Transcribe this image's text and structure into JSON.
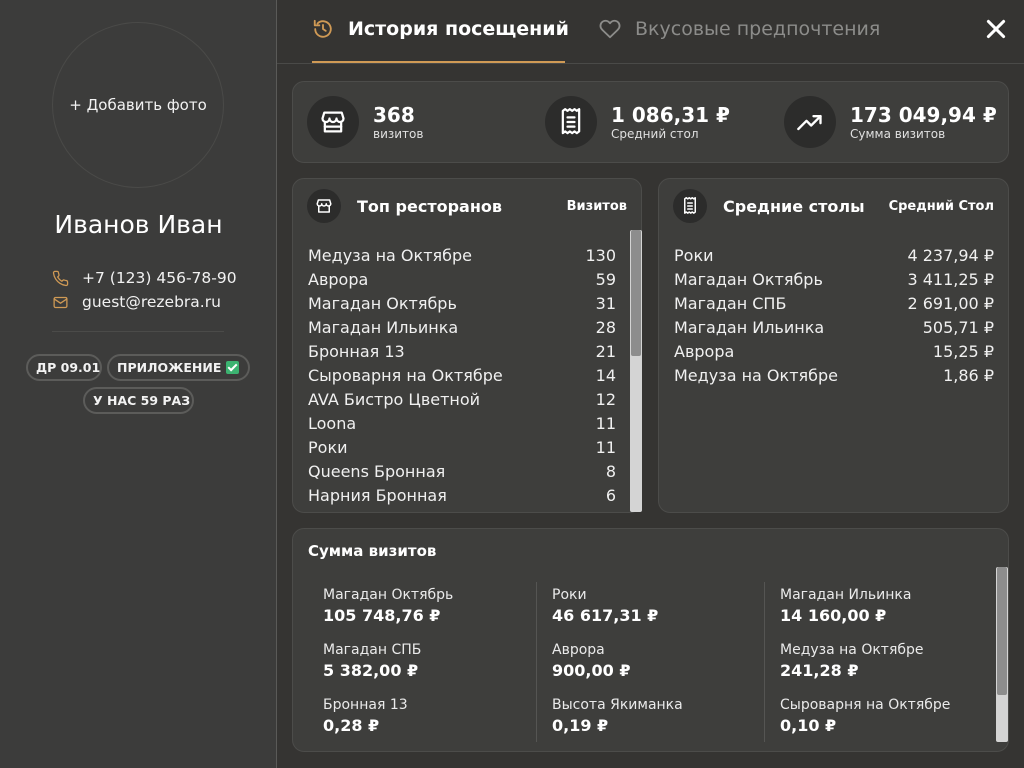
{
  "sidebar": {
    "add_photo": "+ Добавить фото",
    "guest_name": "Иванов Иван",
    "phone": "+7 (123) 456-78-90",
    "email": "guest@rezebra.ru",
    "tags": [
      "ДР 09.01",
      "ПРИЛОЖЕНИЕ",
      "У НАС 59 РАЗ"
    ],
    "accent_color": "#d09a55"
  },
  "tabs": [
    {
      "label": "История посещений",
      "icon": "history-icon",
      "active": true
    },
    {
      "label": "Вкусовые предпочтения",
      "icon": "heart-icon",
      "active": false
    }
  ],
  "stats": [
    {
      "value": "368",
      "label": "визитов",
      "icon": "store-icon"
    },
    {
      "value": "1 086,31 ₽",
      "label": "Средний стол",
      "icon": "receipt-icon"
    },
    {
      "value": "173 049,94 ₽",
      "label": "Сумма визитов",
      "icon": "trend-up-icon"
    }
  ],
  "top_restaurants": {
    "title": "Топ ресторанов",
    "column": "Визитов",
    "rows": [
      {
        "name": "Медуза на Октябре",
        "value": "130"
      },
      {
        "name": "Аврора",
        "value": "59"
      },
      {
        "name": "Магадан Октябрь",
        "value": "31"
      },
      {
        "name": "Магадан Ильинка",
        "value": "28"
      },
      {
        "name": "Бронная 13",
        "value": "21"
      },
      {
        "name": "Сыроварня на Октябре",
        "value": "14"
      },
      {
        "name": "AVA Бистро Цветной",
        "value": "12"
      },
      {
        "name": "Loona",
        "value": "11"
      },
      {
        "name": "Роки",
        "value": "11"
      },
      {
        "name": "Queens Бронная",
        "value": "8"
      },
      {
        "name": "Нарния Бронная",
        "value": "6"
      }
    ]
  },
  "average_tables": {
    "title": "Средние столы",
    "column": "Средний Стол",
    "rows": [
      {
        "name": "Роки",
        "value": "4 237,94 ₽"
      },
      {
        "name": "Магадан Октябрь",
        "value": "3 411,25 ₽"
      },
      {
        "name": "Магадан СПБ",
        "value": "2 691,00 ₽"
      },
      {
        "name": "Магадан Ильинка",
        "value": "505,71 ₽"
      },
      {
        "name": "Аврора",
        "value": "15,25 ₽"
      },
      {
        "name": "Медуза на Октябре",
        "value": "1,86 ₽"
      }
    ]
  },
  "visit_sums": {
    "title": "Сумма визитов",
    "items": [
      {
        "name": "Магадан Октябрь",
        "amount": "105 748,76 ₽"
      },
      {
        "name": "Роки",
        "amount": "46 617,31 ₽"
      },
      {
        "name": "Магадан Ильинка",
        "amount": "14 160,00 ₽"
      },
      {
        "name": "Магадан СПБ",
        "amount": "5 382,00 ₽"
      },
      {
        "name": "Аврора",
        "amount": "900,00 ₽"
      },
      {
        "name": "Медуза на Октябре",
        "amount": "241,28 ₽"
      },
      {
        "name": "Бронная 13",
        "amount": "0,28 ₽"
      },
      {
        "name": "Высота Якиманка",
        "amount": "0,19 ₽"
      },
      {
        "name": "Сыроварня на Октябре",
        "amount": "0,10 ₽"
      }
    ]
  }
}
